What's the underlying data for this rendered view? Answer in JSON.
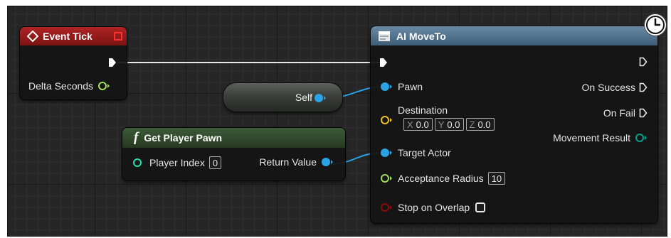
{
  "event_tick": {
    "title": "Event Tick",
    "header_icon": "event-diamond-icon",
    "delegate_icon": "delegate-square-icon",
    "output": "Delta Seconds",
    "colors": {
      "header": "#8f1a1a",
      "delegate": "#e02020",
      "float_pin": "#9fe05a"
    }
  },
  "self_node": {
    "label": "Self",
    "pin_color": "#29a3e5"
  },
  "get_player_pawn": {
    "title": "Get Player Pawn",
    "header_icon": "function-f-icon",
    "input_label": "Player Index",
    "input_value": "0",
    "output_label": "Return Value",
    "colors": {
      "header": "#2f4a2c",
      "int_pin": "#1fe0b0",
      "object_pin": "#29a3e5"
    }
  },
  "ai_moveto": {
    "title": "AI MoveTo",
    "header_icon": "async-task-icon",
    "inputs": {
      "pawn": "Pawn",
      "destination": "Destination",
      "target_actor": "Target Actor",
      "acceptance_radius": "Acceptance Radius",
      "acceptance_radius_value": "10",
      "stop_on_overlap": "Stop on Overlap"
    },
    "vector": {
      "x_label": "X",
      "x_value": "0.0",
      "y_label": "Y",
      "y_value": "0.0",
      "z_label": "Z",
      "z_value": "0.0"
    },
    "outputs": {
      "on_success": "On Success",
      "on_fail": "On Fail",
      "movement_result": "Movement Result"
    },
    "colors": {
      "header": "#4b6a86",
      "vector_pin": "#f0c023",
      "float_pin": "#9fe05a",
      "bool_pin": "#8c0d0d",
      "enum_pin": "#00a28a"
    }
  },
  "latent_badge": {
    "icon": "clock-icon"
  }
}
